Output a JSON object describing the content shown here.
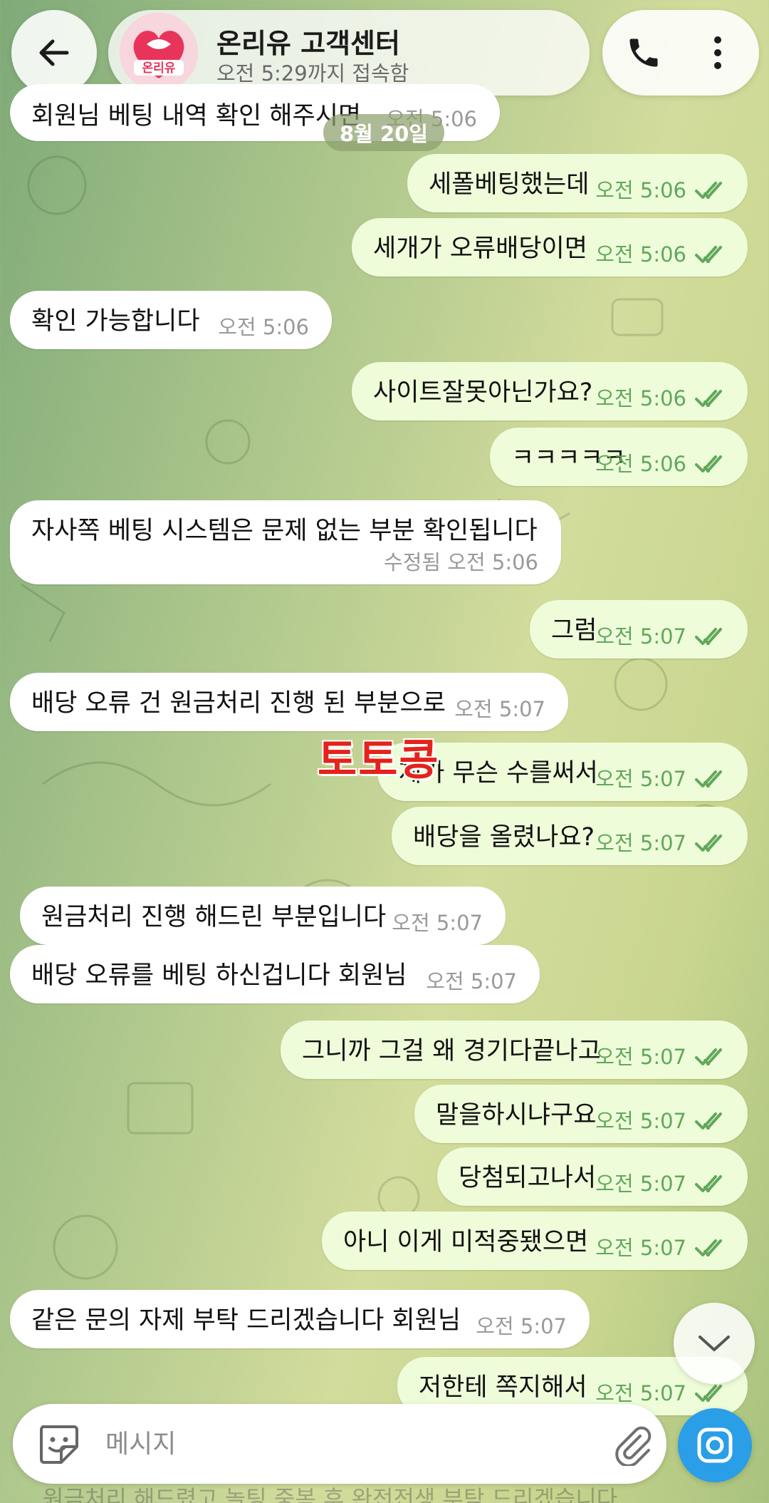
{
  "header": {
    "back_label": "←",
    "title": "온리유 고객센터",
    "status": "오전 5:29까지 접속함",
    "avatar_text": "온리유",
    "accent": "#e8345a"
  },
  "date_chip": "8월 20일",
  "watermark": "토토콩",
  "messages": [
    {
      "dir": "in",
      "text": "회원님 베팅 내역 확인 해주시면",
      "time": "오전 5:06"
    },
    {
      "dir": "out",
      "text": "세폴베팅했는데",
      "time": "오전 5:06"
    },
    {
      "dir": "out",
      "text": "세개가 오류배당이면",
      "time": "오전 5:06"
    },
    {
      "dir": "in",
      "text": "확인 가능합니다",
      "time": "오전 5:06"
    },
    {
      "dir": "out",
      "text": "사이트잘못아닌가요?",
      "time": "오전 5:06"
    },
    {
      "dir": "out",
      "text": "ㅋㅋㅋㅋㅋ",
      "time": "오전 5:06"
    },
    {
      "dir": "in",
      "text": "자사쪽 베팅 시스템은 문제 없는 부분 확인됩니다",
      "time": "수정됨 오전 5:06"
    },
    {
      "dir": "out",
      "text": "그럼",
      "time": "오전 5:07"
    },
    {
      "dir": "in",
      "text": "배당 오류 건 원금처리 진행 된 부분으로",
      "time": "오전 5:07"
    },
    {
      "dir": "out",
      "text": "제가 무슨 수를써서",
      "time": "오전 5:07"
    },
    {
      "dir": "out",
      "text": "배당을 올렸나요?",
      "time": "오전 5:07"
    },
    {
      "dir": "in",
      "text": "원금처리 진행 해드린 부분입니다",
      "time": "오전 5:07"
    },
    {
      "dir": "in",
      "text": "배당 오류를 베팅 하신겁니다 회원님",
      "time": "오전 5:07"
    },
    {
      "dir": "out",
      "text": "그니까 그걸 왜 경기다끝나고",
      "time": "오전 5:07"
    },
    {
      "dir": "out",
      "text": "말을하시냐구요",
      "time": "오전 5:07"
    },
    {
      "dir": "out",
      "text": "당첨되고나서",
      "time": "오전 5:07"
    },
    {
      "dir": "out",
      "text": "아니 이게 미적중됐으면",
      "time": "오전 5:07"
    },
    {
      "dir": "in",
      "text": "같은 문의 자제 부탁 드리겠습니다 회원님",
      "time": "오전 5:07"
    },
    {
      "dir": "out",
      "text": "저한테 쪽지해서",
      "time": "오전 5:07"
    }
  ],
  "composer": {
    "placeholder": "메시지",
    "ghost_text": "원금처리 해드렸고 놀팅 중복 후 완전전생 부탁 드리겠습니다"
  },
  "icons": [
    "back-arrow-icon",
    "phone-icon",
    "more-vertical-icon",
    "chevron-down-icon",
    "sticker-icon",
    "paperclip-icon",
    "camera-icon",
    "double-check-icon"
  ]
}
